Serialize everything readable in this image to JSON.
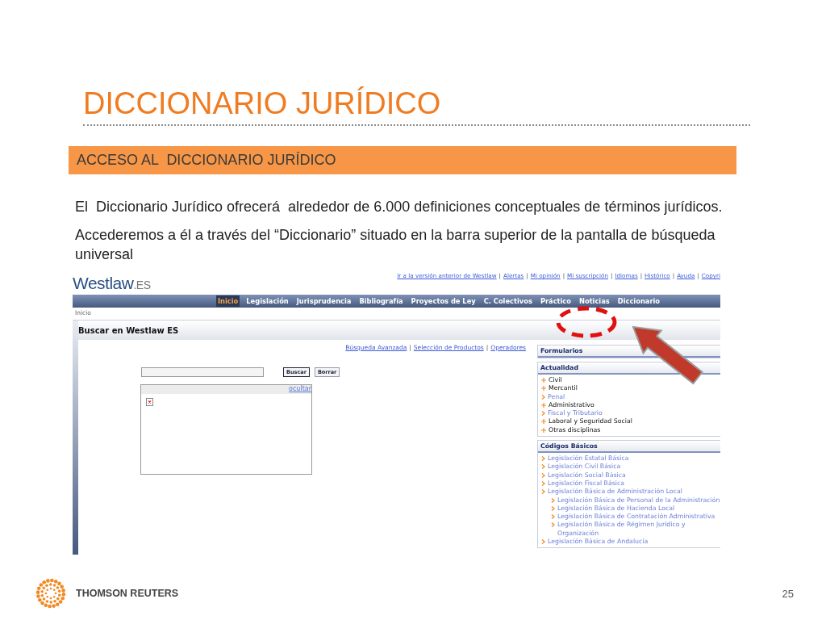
{
  "slide": {
    "title": "DICCIONARIO JURÍDICO",
    "section": "ACCESO AL  DICCIONARIO JURÍDICO",
    "paragraphs": [
      "El  Diccionario Jurídico ofrecerá  alrededor de 6.000 definiciones conceptuales de términos jurídicos.",
      "Accederemos a él a través del “Diccionario” situado en la barra superior de la pantalla de búsqueda universal"
    ],
    "brand": "THOMSON REUTERS",
    "page_number": "25"
  },
  "screenshot": {
    "logo_main": "Westlaw",
    "logo_suffix": ".ES",
    "separator": "|",
    "top_links": [
      "Ir a la versión anterior de Westlaw",
      "Alertas",
      "Mi opinión",
      "Mi suscripción",
      "Idiomas",
      "Histórico",
      "Ayuda",
      "Copyri"
    ],
    "nav": [
      {
        "label": "Inicio",
        "selected": true
      },
      {
        "label": "Legislación",
        "selected": false
      },
      {
        "label": "Jurisprudencia",
        "selected": false
      },
      {
        "label": "Bibliografía",
        "selected": false
      },
      {
        "label": "Proyectos de Ley",
        "selected": false
      },
      {
        "label": "C. Colectivos",
        "selected": false
      },
      {
        "label": "Práctico",
        "selected": false
      },
      {
        "label": "Noticias",
        "selected": false
      },
      {
        "label": "Diccionario",
        "selected": false
      }
    ],
    "breadcrumb": "Inicio",
    "panel_title": "Buscar en Westlaw ES",
    "search_links": [
      "Búsqueda Avanzada",
      "Selección de Productos",
      "Operadores"
    ],
    "buttons": [
      "Buscar",
      "Borrar"
    ],
    "hide_link": "ocultar",
    "sidebar": [
      {
        "title": "Formularios"
      },
      {
        "title": "Actualidad",
        "items": [
          {
            "label": "Civil",
            "kind": "category"
          },
          {
            "label": "Mercantil",
            "kind": "category"
          },
          {
            "label": "Penal",
            "kind": "link"
          },
          {
            "label": "Administrativo",
            "kind": "category"
          },
          {
            "label": "Fiscal y Tributario",
            "kind": "link"
          },
          {
            "label": "Laboral y Seguridad Social",
            "kind": "category"
          },
          {
            "label": "Otras disciplinas",
            "kind": "category"
          }
        ]
      },
      {
        "title": "Códigos Básicos",
        "items": [
          {
            "label": "Legislación Estatal Básica",
            "kind": "link"
          },
          {
            "label": "Legislación Civil Básica",
            "kind": "link"
          },
          {
            "label": "Legislación Social Básica",
            "kind": "link"
          },
          {
            "label": "Legislación Fiscal Básica",
            "kind": "link"
          },
          {
            "label": "Legislación Básica de Administración Local",
            "kind": "link",
            "children": [
              {
                "label": "Legislación Básica de Personal de la Administración",
                "kind": "link"
              },
              {
                "label": "Legislación Básica de Hacienda Local",
                "kind": "link"
              },
              {
                "label": "Legislación Básica de Contratación Administrativa",
                "kind": "link"
              },
              {
                "label": "Legislación Básica de Régimen Jurídico y Organización",
                "kind": "link"
              }
            ]
          },
          {
            "label": "Legislación Básica de Andalucía",
            "kind": "link"
          }
        ]
      }
    ]
  }
}
